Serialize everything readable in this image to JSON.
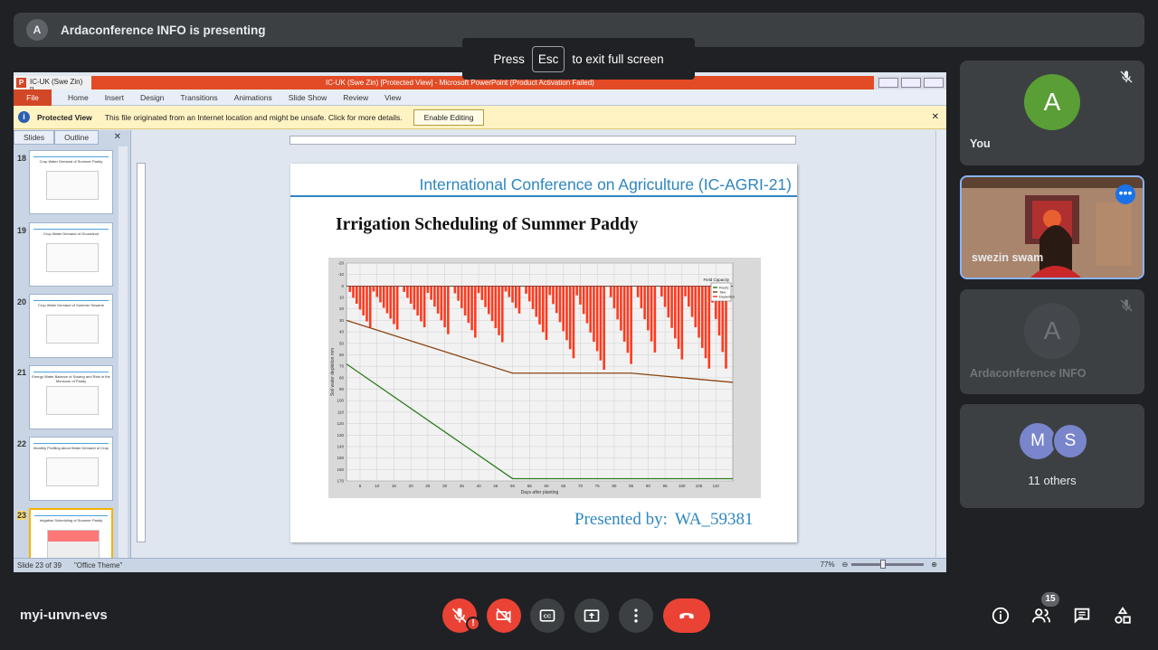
{
  "banner": {
    "avatar_letter": "A",
    "text": "Ardaconference INFO is presenting"
  },
  "esc_hint": {
    "press": "Press",
    "key": "Esc",
    "rest": "to exit full screen"
  },
  "ppt": {
    "window_left": "IC-UK (Swe Zin) [I",
    "window_title": "IC-UK (Swe Zin) [Protected View] - Microsoft PowerPoint (Product Activation Failed)",
    "ribbon_tabs": [
      "File",
      "Home",
      "Insert",
      "Design",
      "Transitions",
      "Animations",
      "Slide Show",
      "Review",
      "View"
    ],
    "protected": {
      "label": "Protected View",
      "message": "This file originated from an Internet location and might be unsafe. Click for more details.",
      "button": "Enable Editing"
    },
    "panel_tabs": {
      "slides": "Slides",
      "outline": "Outline"
    },
    "thumbnails": [
      {
        "num": "18",
        "title": "Crop Water Demand of Summer Paddy"
      },
      {
        "num": "19",
        "title": "Crop Water Demand of Groundnut"
      },
      {
        "num": "20",
        "title": "Crop Water Demand of Summer Sesame"
      },
      {
        "num": "21",
        "title": "Energy Water Balance of Sowing and Rain in the Monsoon of Paddy"
      },
      {
        "num": "22",
        "title": "Monthly Profiling about Water Demand of Crop"
      },
      {
        "num": "23",
        "title": "Irrigation Scheduling of Summer Paddy"
      }
    ],
    "status": {
      "slide": "Slide 23 of 39",
      "theme": "\"Office Theme\"",
      "zoom": "77%"
    }
  },
  "slide": {
    "conference": "International Conference on Agriculture (IC-AGRI-21)",
    "heading": "Irrigation  Scheduling of Summer Paddy",
    "presented_label": "Presented by:",
    "presenter_id": "WA_59381",
    "chart_xlabel": "Days after planting",
    "chart_ylabel": "Soil water depletion mm",
    "legend_title": "Field Capacity",
    "legend": [
      "Roots",
      "Taw",
      "Depletion"
    ]
  },
  "chart_data": {
    "type": "bar",
    "title": "",
    "xlabel": "Days after planting",
    "ylabel": "Soil water depletion mm",
    "x_ticks": [
      5,
      10,
      15,
      20,
      25,
      30,
      35,
      40,
      45,
      50,
      55,
      60,
      65,
      70,
      75,
      80,
      85,
      90,
      95,
      100,
      105,
      110
    ],
    "y_ticks": [
      -20,
      -10,
      0,
      10,
      20,
      30,
      40,
      50,
      60,
      70,
      80,
      90,
      100,
      110,
      120,
      130,
      140,
      150,
      160,
      170
    ],
    "xlim": [
      1,
      115
    ],
    "ylim": [
      -20,
      170
    ],
    "series": [
      {
        "name": "Depletion",
        "color": "#ff3a1f",
        "cycles": [
          [
            2,
            8,
            36
          ],
          [
            9,
            16,
            38
          ],
          [
            18,
            24,
            36
          ],
          [
            25,
            31,
            42
          ],
          [
            33,
            39,
            45
          ],
          [
            40,
            47,
            49
          ],
          [
            48,
            52,
            24
          ],
          [
            54,
            60,
            47
          ],
          [
            61,
            68,
            63
          ],
          [
            69,
            77,
            73
          ],
          [
            79,
            85,
            68
          ],
          [
            87,
            92,
            58
          ],
          [
            94,
            100,
            64
          ],
          [
            101,
            108,
            72
          ],
          [
            109,
            113,
            72
          ]
        ]
      },
      {
        "name": "Roots",
        "color": "#2e7d1e",
        "points": [
          [
            1,
            68
          ],
          [
            50,
            168
          ],
          [
            115,
            168
          ]
        ]
      },
      {
        "name": "Taw",
        "color": "#8b4513",
        "points": [
          [
            1,
            30
          ],
          [
            50,
            76
          ],
          [
            85,
            76
          ],
          [
            115,
            84
          ]
        ]
      }
    ]
  },
  "tiles": [
    {
      "letter": "A",
      "name": "You",
      "color": "#5a9e36"
    },
    {
      "name": "swezin swam"
    },
    {
      "letter": "A",
      "name": "Ardaconference INFO"
    },
    {
      "letters": [
        "M",
        "S"
      ],
      "name": "11 others",
      "color": "#7986cb"
    }
  ],
  "bottom": {
    "meeting_code": "myi-unvn-evs",
    "people_count": "15"
  }
}
